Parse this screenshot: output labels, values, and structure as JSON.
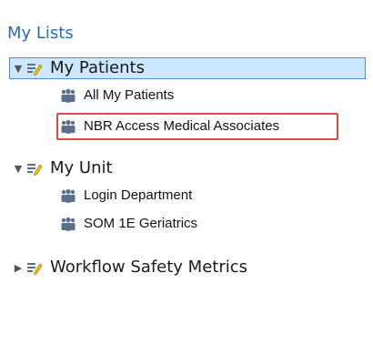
{
  "title": "My Lists",
  "groups": [
    {
      "label": "My Patients",
      "expanded": true,
      "selected": true,
      "items": [
        {
          "label": "All My Patients"
        },
        {
          "label": "NBR Access Medical Associates"
        }
      ]
    },
    {
      "label": "My Unit",
      "expanded": true,
      "items": [
        {
          "label": "Login Department"
        },
        {
          "label": "SOM 1E Geriatrics"
        }
      ]
    },
    {
      "label": "Workflow Safety Metrics",
      "expanded": false,
      "items": []
    }
  ],
  "icons": {
    "expanded_arrow": "▼",
    "collapsed_arrow": "▶",
    "list_icon": "list-pencil-icon",
    "patient_group_icon": "people-icon"
  },
  "colors": {
    "title": "#2b6cb0",
    "selection_bg": "#cce8ff",
    "selection_border": "#4a90d9",
    "highlight_border": "#e04848",
    "icon": "#5a6f88"
  }
}
